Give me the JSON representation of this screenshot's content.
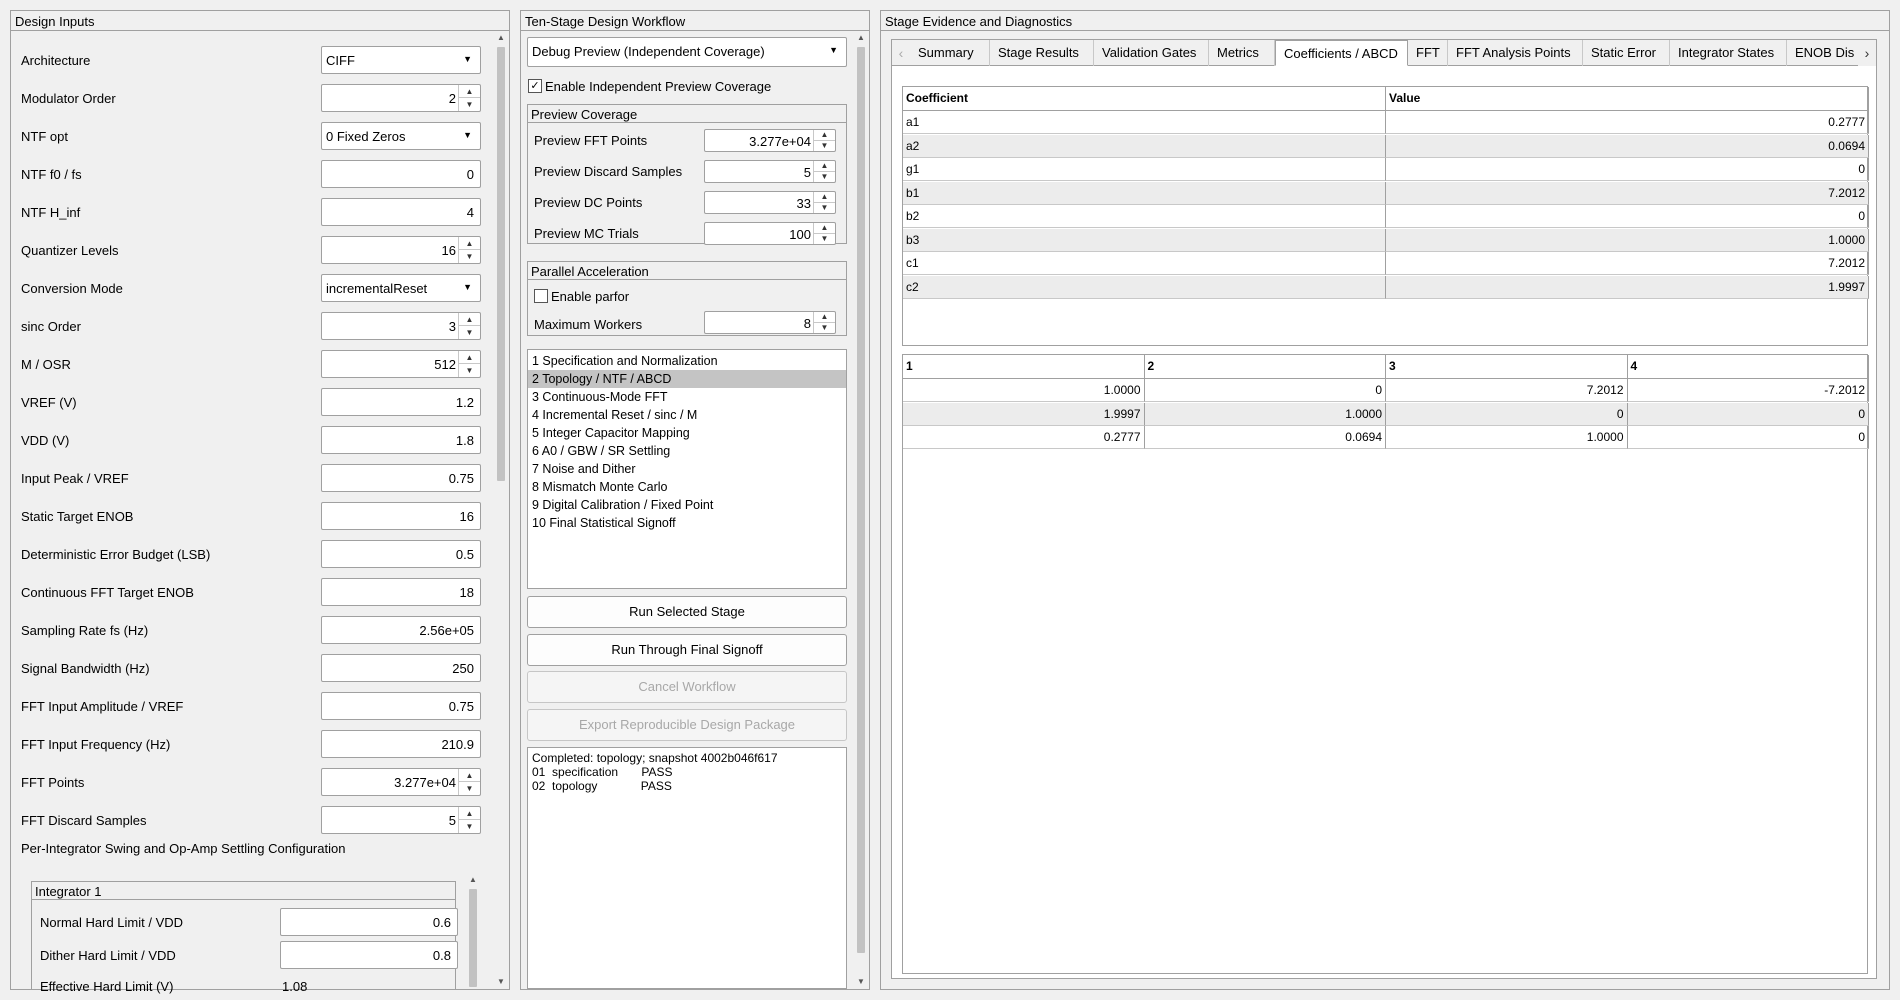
{
  "left_panel": {
    "title": "Design Inputs",
    "fields": [
      {
        "label": "Architecture",
        "kind": "dropdown",
        "value": "CIFF"
      },
      {
        "label": "Modulator Order",
        "kind": "spin",
        "value": "2"
      },
      {
        "label": "NTF opt",
        "kind": "dropdown",
        "value": "0 Fixed Zeros"
      },
      {
        "label": "NTF f0 / fs",
        "kind": "text",
        "value": "0"
      },
      {
        "label": "NTF H_inf",
        "kind": "text",
        "value": "4"
      },
      {
        "label": "Quantizer Levels",
        "kind": "spin",
        "value": "16"
      },
      {
        "label": "Conversion Mode",
        "kind": "dropdown",
        "value": "incrementalReset"
      },
      {
        "label": "sinc Order",
        "kind": "spin",
        "value": "3"
      },
      {
        "label": "M / OSR",
        "kind": "spin",
        "value": "512"
      },
      {
        "label": "VREF (V)",
        "kind": "text",
        "value": "1.2"
      },
      {
        "label": "VDD (V)",
        "kind": "text",
        "value": "1.8"
      },
      {
        "label": "Input Peak / VREF",
        "kind": "text",
        "value": "0.75"
      },
      {
        "label": "Static Target ENOB",
        "kind": "text",
        "value": "16"
      },
      {
        "label": "Deterministic Error Budget (LSB)",
        "kind": "text",
        "value": "0.5"
      },
      {
        "label": "Continuous FFT Target ENOB",
        "kind": "text",
        "value": "18"
      },
      {
        "label": "Sampling Rate fs (Hz)",
        "kind": "text",
        "value": "2.56e+05"
      },
      {
        "label": "Signal Bandwidth (Hz)",
        "kind": "text",
        "value": "250"
      },
      {
        "label": "FFT Input Amplitude / VREF",
        "kind": "text",
        "value": "0.75"
      },
      {
        "label": "FFT Input Frequency (Hz)",
        "kind": "text",
        "value": "210.9"
      },
      {
        "label": "FFT Points",
        "kind": "spin",
        "value": "3.277e+04"
      },
      {
        "label": "FFT Discard Samples",
        "kind": "spin",
        "value": "5"
      }
    ],
    "per_integrator_label": "Per-Integrator Swing and Op-Amp Settling Configuration",
    "integrator1": {
      "title": "Integrator 1",
      "normal_label": "Normal Hard Limit / VDD",
      "normal_value": "0.6",
      "dither_label": "Dither Hard Limit / VDD",
      "dither_value": "0.8",
      "effective_label": "Effective Hard Limit (V)",
      "effective_value": "1.08"
    }
  },
  "middle_panel": {
    "title": "Ten-Stage Design Workflow",
    "mode": "Debug Preview (Independent Coverage)",
    "independent_label": "Enable Independent Preview Coverage",
    "independent_checked": "✓",
    "preview": {
      "title": "Preview Coverage",
      "rows": [
        {
          "label": "Preview FFT Points",
          "value": "3.277e+04"
        },
        {
          "label": "Preview Discard Samples",
          "value": "5"
        },
        {
          "label": "Preview DC Points",
          "value": "33"
        },
        {
          "label": "Preview MC Trials",
          "value": "100"
        }
      ]
    },
    "parallel": {
      "title": "Parallel Acceleration",
      "parfor_label": "Enable parfor",
      "workers_label": "Maximum Workers",
      "workers_value": "8"
    },
    "stages": [
      "1 Specification and Normalization",
      "2 Topology / NTF / ABCD",
      "3 Continuous-Mode FFT",
      "4 Incremental Reset / sinc / M",
      "5 Integer Capacitor Mapping",
      "6 A0 / GBW / SR Settling",
      "7 Noise and Dither",
      "8 Mismatch Monte Carlo",
      "9 Digital Calibration / Fixed Point",
      "10 Final Statistical Signoff"
    ],
    "selected_stage_index": 1,
    "buttons": {
      "run_selected": "Run Selected Stage",
      "run_through": "Run Through Final Signoff",
      "cancel": "Cancel Workflow",
      "export": "Export Reproducible Design Package"
    },
    "log": "Completed: topology; snapshot 4002b046f617\n01  specification       PASS\n02  topology             PASS"
  },
  "right_panel": {
    "title": "Stage Evidence and Diagnostics",
    "tabs": [
      "Summary",
      "Stage Results",
      "Validation Gates",
      "Metrics",
      "Coefficients / ABCD",
      "FFT",
      "FFT Analysis Points",
      "Static Error",
      "Integrator States",
      "ENOB Dis"
    ],
    "active_tab": "Coefficients / ABCD",
    "coef_table": {
      "headers": [
        "Coefficient",
        "Value"
      ],
      "rows": [
        [
          "a1",
          "0.2777"
        ],
        [
          "a2",
          "0.0694"
        ],
        [
          "g1",
          "0"
        ],
        [
          "b1",
          "7.2012"
        ],
        [
          "b2",
          "0"
        ],
        [
          "b3",
          "1.0000"
        ],
        [
          "c1",
          "7.2012"
        ],
        [
          "c2",
          "1.9997"
        ]
      ]
    },
    "abcd_table": {
      "headers": [
        "1",
        "2",
        "3",
        "4"
      ],
      "rows": [
        [
          "1.0000",
          "0",
          "7.2012",
          "-7.2012"
        ],
        [
          "1.9997",
          "1.0000",
          "0",
          "0"
        ],
        [
          "0.2777",
          "0.0694",
          "1.0000",
          "0"
        ]
      ]
    }
  }
}
